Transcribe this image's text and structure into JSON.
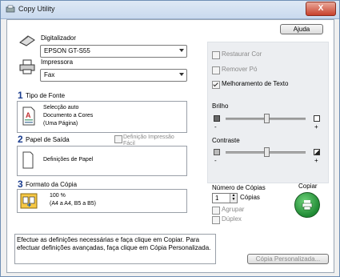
{
  "window": {
    "title": "Copy Utility",
    "close_label": "X"
  },
  "help_button": "Ajuda",
  "scanner": {
    "label": "Digitalizador",
    "value": "EPSON GT-S55"
  },
  "printer": {
    "label": "Impressora",
    "value": "Fax"
  },
  "section1": {
    "number": "1",
    "label": "Tipo de Fonte",
    "text": [
      "Selecção auto",
      "Documento a Cores",
      "(Uma Página)"
    ]
  },
  "section2": {
    "number": "2",
    "label": "Papel de Saída",
    "option": "Definição Impressão Fácil",
    "text": "Definições de Papel"
  },
  "section3": {
    "number": "3",
    "label": "Formato da Cópia",
    "text": [
      "100 %",
      "(A4 a A4, B5 a B5)"
    ]
  },
  "options": {
    "restaurar_cor": "Restaurar Cor",
    "remover_po": "Remover Pó",
    "melhoramento_texto": "Melhoramento de Texto"
  },
  "brilho": {
    "label": "Brilho",
    "minus": "-",
    "plus": "+",
    "level": 0.5
  },
  "contraste": {
    "label": "Contraste",
    "minus": "-",
    "plus": "+",
    "level": 0.5
  },
  "copies": {
    "label": "Número de Cópias",
    "value": "1",
    "unit": "Cópias",
    "agrupar": "Agrupar",
    "duplex": "Dúplex"
  },
  "copy_button": {
    "label": "Copiar"
  },
  "info": "Efectue as definições necessárias e faça clique em Copiar. Para efectuar definições avançadas, faça clique em Cópia Personalizada.",
  "custom_copy_button": "Cópia Personalizada..."
}
